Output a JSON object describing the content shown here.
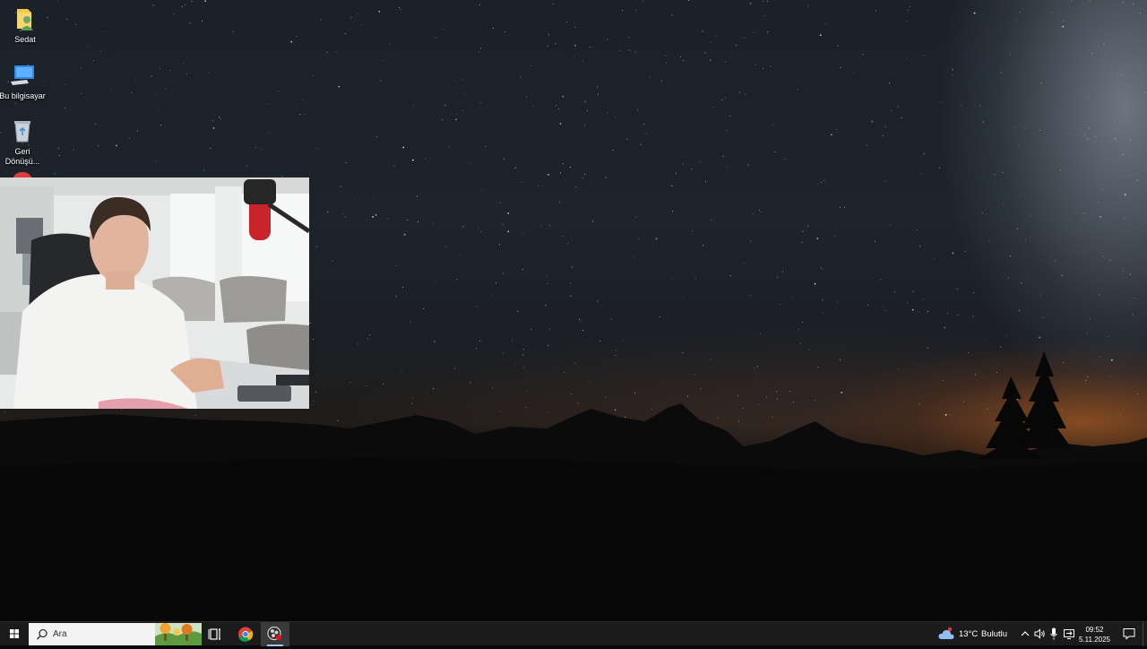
{
  "desktop": {
    "icons": [
      {
        "label": "Sedat",
        "icon": "user-folder-icon"
      },
      {
        "label": "Bu bilgisayar",
        "icon": "this-pc-icon"
      },
      {
        "label": "Geri Dönüşü...",
        "icon": "recycle-bin-icon"
      }
    ],
    "wallpaper": "night-sky-mountains"
  },
  "webcam": {
    "description_icon": "webcam-overlay"
  },
  "taskbar": {
    "search_placeholder": "Ara",
    "pinned": [
      {
        "name": "task-view",
        "icon": "task-view-icon"
      },
      {
        "name": "chrome",
        "icon": "chrome-icon"
      },
      {
        "name": "obs",
        "icon": "obs-recording-icon",
        "active": true
      }
    ],
    "weather": {
      "temp": "13°C",
      "condition": "Bulutlu",
      "icon": "cloud-weather-icon"
    },
    "clock": {
      "time": "09:52",
      "date": "5.11.2025"
    }
  },
  "colors": {
    "taskbar_bg": "#1b1b1c",
    "accent": "#9ec7f0",
    "search_bg": "#f3f3f3"
  }
}
